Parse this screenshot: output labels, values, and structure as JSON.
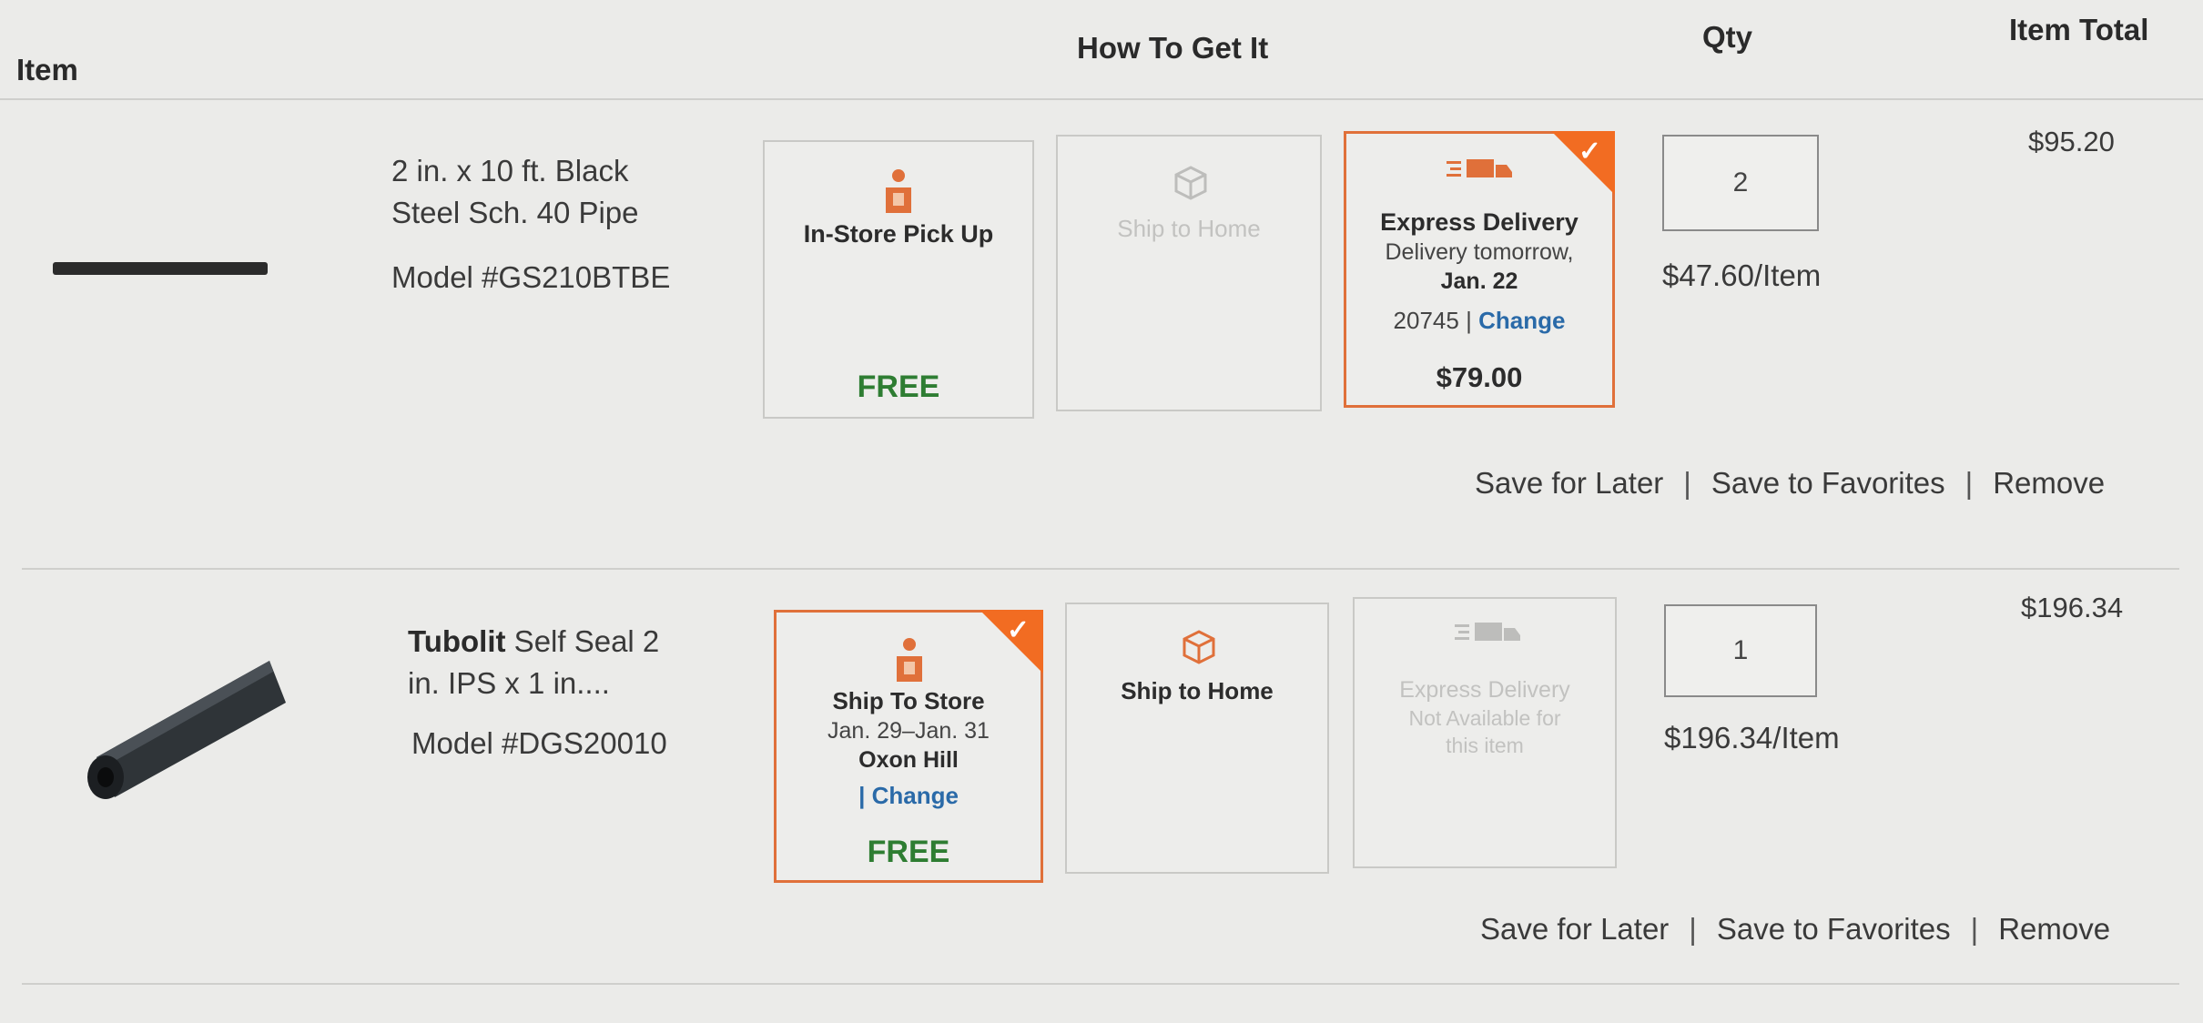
{
  "header": {
    "item": "Item",
    "how": "How To Get It",
    "qty": "Qty",
    "total": "Item Total"
  },
  "items": [
    {
      "name": "2 in. x 10 ft. Black Steel Sch. 40 Pipe",
      "model": "Model #GS210BTBE",
      "options": {
        "pickup": {
          "title": "In-Store Pick Up",
          "price": "FREE",
          "icon": "store-pickup-icon"
        },
        "ship": {
          "title": "Ship to Home",
          "icon": "box-icon"
        },
        "express": {
          "title": "Express Delivery",
          "line1": "Delivery tomorrow,",
          "line2": "Jan. 22",
          "zip": "20745",
          "change": "Change",
          "price": "$79.00",
          "icon": "truck-icon",
          "selected": true
        }
      },
      "qty": "2",
      "unit_price": "$47.60/Item",
      "total": "$95.20"
    },
    {
      "name_bold": "Tubolit",
      "name_rest": " Self Seal 2 in. IPS x 1 in....",
      "model": "Model #DGS20010",
      "options": {
        "store": {
          "title": "Ship To Store",
          "dates": "Jan. 29–Jan. 31",
          "location": "Oxon Hill",
          "change": "| Change",
          "price": "FREE",
          "icon": "store-pickup-icon",
          "selected": true
        },
        "ship": {
          "title": "Ship to Home",
          "icon": "box-icon"
        },
        "express": {
          "title": "Express Delivery",
          "line1": "Not Available for",
          "line2": "this item",
          "icon": "truck-icon"
        }
      },
      "qty": "1",
      "unit_price": "$196.34/Item",
      "total": "$196.34"
    }
  ],
  "actions": {
    "save_later": "Save for Later",
    "save_fav": "Save to Favorites",
    "remove": "Remove",
    "separator": "|"
  },
  "colors": {
    "accent": "#f26c22",
    "free": "#2e7d32",
    "link": "#2a6aa8"
  }
}
